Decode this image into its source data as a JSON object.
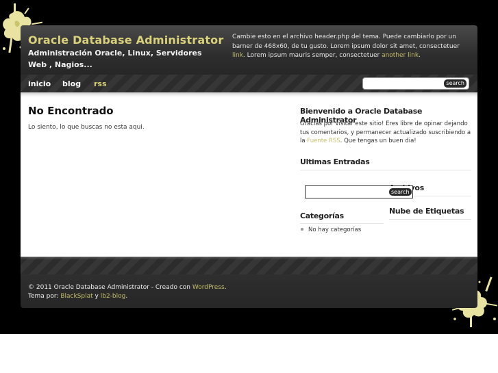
{
  "header": {
    "title": "Oracle Database Administrator",
    "description": "Administración Oracle, Linux, Servidores Web , Nagios...",
    "banner_text": "Cambie esto en el archivo header.php del tema. Puede cambiarlo por un barner de 468x60, de tu gusto. Lorem ipsum dolor sit amet, consectetuer",
    "banner_link1": "link",
    "banner_mid": ". Lorem ipsum mauris semper, consectetuer",
    "banner_link2": "another link",
    "banner_end": "."
  },
  "nav": {
    "items": [
      "inicio",
      "blog",
      "rss"
    ],
    "search_button": "search",
    "search_value": ""
  },
  "main": {
    "title": "No Encontrado",
    "text": "Lo siento, lo que buscas no esta aqui."
  },
  "sidebar": {
    "welcome_title": "Bienvenido a Oracle Database Administrator",
    "welcome_text": "Gracias por visitar este sitio! Eres libre de opinar dejando tus comentarios, y permanecer actualizado suscribiendo a la",
    "welcome_link": "Fuente RSS",
    "welcome_end": ". Que tengas un buen dia!",
    "latest_title": "Ultimas Entradas",
    "archives_title": "Archivos",
    "search_button": "search",
    "categories_title": "Categorías",
    "categories_empty": "No hay categorías",
    "tags_title": "Nube de Etiquetas"
  },
  "footer": {
    "line1_prefix": "© 2011 Oracle Database Administrator - Creado con",
    "line1_link": "WordPress",
    "line1_end": ".",
    "line2_prefix": "Tema por:",
    "line2_link1": "BlackSplat",
    "line2_mid": "y",
    "line2_link2": "lb2-blog",
    "line2_end": "."
  },
  "colors": {
    "accent": "#d9d27a",
    "link": "#c5bd6a",
    "background": "#000000",
    "splat": "#e8e3a0"
  }
}
